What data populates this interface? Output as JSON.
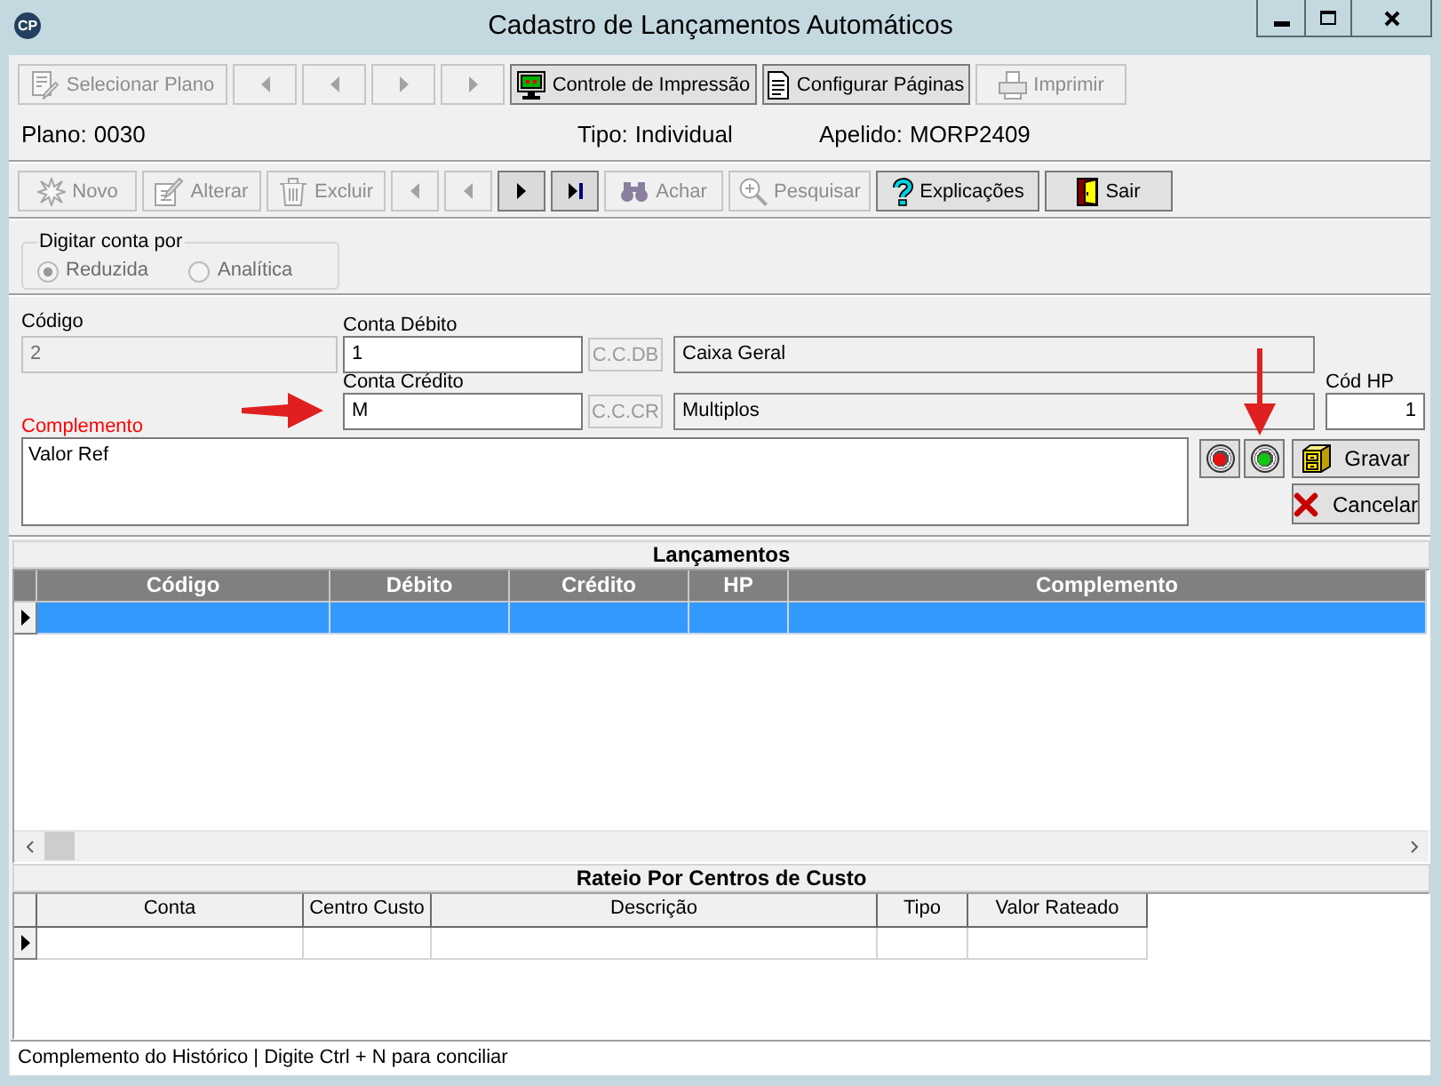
{
  "window": {
    "logo": "CP",
    "title": "Cadastro de Lançamentos Automáticos"
  },
  "print_toolbar": [
    {
      "kind": "button",
      "label": "Selecionar Plano",
      "disabled": true
    },
    {
      "kind": "nav",
      "disabled": true
    },
    {
      "kind": "nav",
      "disabled": true
    },
    {
      "kind": "nav",
      "disabled": true
    },
    {
      "kind": "nav",
      "disabled": true
    },
    {
      "kind": "button",
      "label": "Controle de Impressão",
      "disabled": false
    },
    {
      "kind": "button",
      "label": "Configurar Páginas",
      "disabled": false
    },
    {
      "kind": "button",
      "label": "Imprimir",
      "disabled": true
    }
  ],
  "plan_info": [
    {
      "label": "Plano:",
      "value": "0030"
    },
    {
      "label": "Tipo:",
      "value": "Individual"
    },
    {
      "label": "Apelido:",
      "value": "MORP2409"
    }
  ],
  "record_toolbar": [
    {
      "kind": "button",
      "label": "Novo",
      "disabled": true
    },
    {
      "kind": "button",
      "label": "Alterar",
      "disabled": true
    },
    {
      "kind": "button",
      "label": "Excluir",
      "disabled": true
    },
    {
      "kind": "nav",
      "disabled": true
    },
    {
      "kind": "nav",
      "disabled": true
    },
    {
      "kind": "nav",
      "disabled": false
    },
    {
      "kind": "nav",
      "disabled": false
    },
    {
      "kind": "button",
      "label": "Achar",
      "disabled": true
    },
    {
      "kind": "button",
      "label": "Pesquisar",
      "disabled": true
    },
    {
      "kind": "button",
      "label": "Explicações",
      "disabled": false
    },
    {
      "kind": "button",
      "label": "Sair",
      "disabled": false
    }
  ],
  "account_entry_mode": {
    "title": "Digitar conta por",
    "disabled": true,
    "options": [
      {
        "label": "Reduzida",
        "selected": true
      },
      {
        "label": "Analítica",
        "selected": false
      }
    ]
  },
  "form": {
    "code": {
      "label": "Código",
      "value": "2",
      "disabled": true
    },
    "accounts": [
      {
        "label": "Conta Débito",
        "value": "1",
        "cost_center_button": {
          "label": "C.C.DB",
          "disabled": true
        },
        "description": "Caixa Geral",
        "arrow_marked": false
      },
      {
        "label": "Conta Crédito",
        "value": "M",
        "cost_center_button": {
          "label": "C.C.CR",
          "disabled": true
        },
        "description": "Multiplos",
        "arrow_marked": true
      }
    ],
    "hp_code": {
      "label": "Cód HP",
      "value": "1"
    },
    "complement": {
      "label": "Complemento",
      "value": "Valor Ref",
      "required": true
    },
    "signal_buttons": [
      {
        "color": "#e81010",
        "arrow_marked": false
      },
      {
        "color": "#10c810",
        "arrow_marked": true
      }
    ],
    "actions": [
      {
        "label": "Gravar"
      },
      {
        "label": "Cancelar"
      }
    ]
  },
  "entries_grid": {
    "title": "Lançamentos",
    "kind": "main",
    "columns": [
      "Código",
      "Débito",
      "Crédito",
      "HP",
      "Complemento"
    ],
    "rows": [
      {
        "selected": true,
        "current": true
      }
    ]
  },
  "cost_center_grid": {
    "title": "Rateio Por Centros de Custo",
    "kind": "detail",
    "columns": [
      "Conta",
      "Centro Custo",
      "Descrição",
      "Tipo",
      "Valor Rateado"
    ],
    "rows": [
      {
        "selected": false,
        "current": true
      }
    ]
  },
  "status_bar": {
    "text": "Complemento do Histórico | Digite Ctrl + N para conciliar"
  }
}
